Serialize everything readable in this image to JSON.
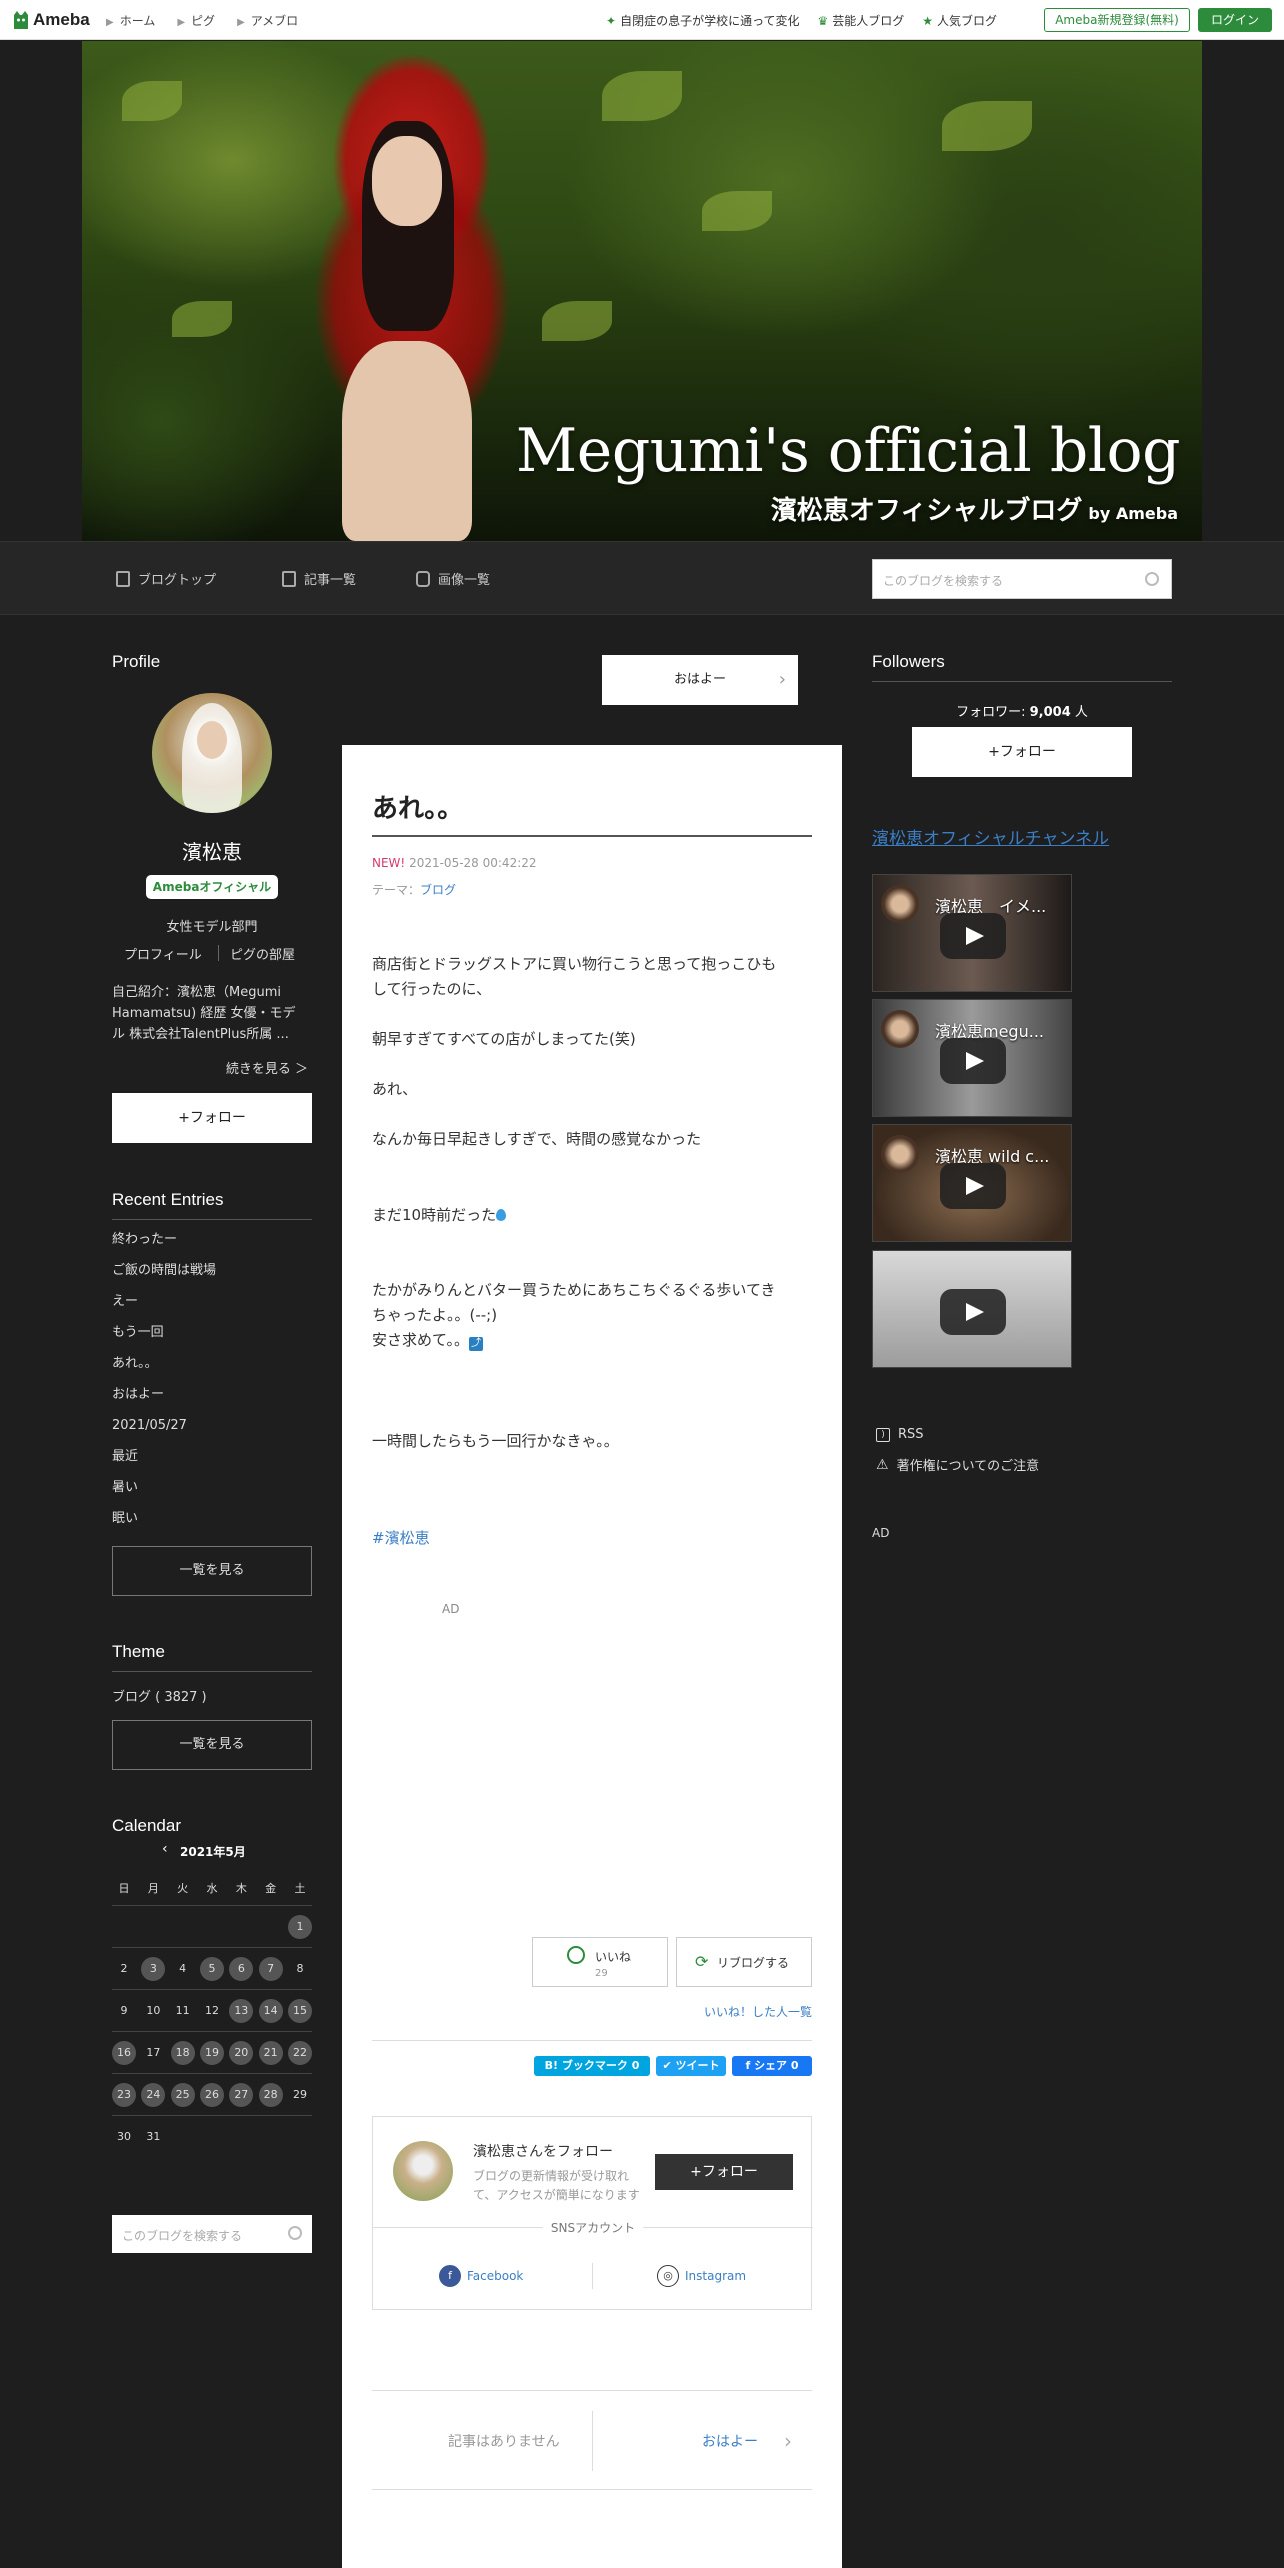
{
  "topbar": {
    "logo": "Ameba",
    "nav": [
      "ホーム",
      "ピグ",
      "アメブロ"
    ],
    "links": [
      "自閉症の息子が学校に通って変化",
      "芸能人ブログ",
      "人気ブログ"
    ],
    "register": "Ameba新規登録(無料)",
    "login": "ログイン"
  },
  "hero": {
    "title": "Megumi's official blog",
    "subtitle": "濱松恵オフィシャルブログ",
    "by": "by Ameba"
  },
  "navbar": {
    "items": [
      "ブログトップ",
      "記事一覧",
      "画像一覧"
    ],
    "search_placeholder": "このブログを検索する"
  },
  "left": {
    "profile_heading": "Profile",
    "name": "濱松恵",
    "badge": "Amebaオフィシャル",
    "occupation": "女性モデル部門",
    "profile_link": "プロフィール",
    "pigg_link": "ピグの部屋",
    "intro_1": "自己紹介：濱松恵（Megumi",
    "intro_2": "Hamamatsu) 経歴 女優・モデ",
    "intro_3": "ル 株式会社TalentPlus所属 ...",
    "read_more": "続きを見る ＞",
    "follow": "+フォロー",
    "recent_heading": "Recent Entries",
    "recent": [
      "終わったー",
      "ご飯の時間は戦場",
      "えー",
      "もう一回",
      "あれ。。",
      "おはよー",
      "2021/05/27",
      "最近",
      "暑い",
      "眠い"
    ],
    "see_all": "一覧を見る",
    "theme_heading": "Theme",
    "theme_item": "ブログ ( 3827 )",
    "theme_see_all": "一覧を見る",
    "calendar_heading": "Calendar",
    "calendar_month": "2021年5月",
    "weekdays": [
      "日",
      "月",
      "火",
      "水",
      "木",
      "金",
      "土"
    ],
    "search_placeholder": "このブログを検索する"
  },
  "article": {
    "prev_button": "おはよー",
    "title": "あれ。。",
    "new_label": "NEW!",
    "datetime": "2021-05-28 00:42:22",
    "theme_label": "テーマ：",
    "theme_value": "ブログ",
    "p1a": "商店街とドラッグストアに買い物行こうと思って抱っこひも",
    "p1b": "して行ったのに、",
    "p2": "朝早すぎてすべての店がしまってた(笑)",
    "p3": "あれ、",
    "p4": "なんか毎日早起きしすぎで、時間の感覚なかった",
    "p5": "まだ10時前だった",
    "p6a": "たかがみりんとバター買うためにあちこちぐるぐる歩いてき",
    "p6b": "ちゃったよ。。(--;)",
    "p6c": "安さ求めて。。",
    "p7": "一時間したらもう一回行かなきゃ。。",
    "hashtag": "#濱松恵",
    "ad": "AD",
    "like_label": "いいね",
    "like_count": "29",
    "reblog": "リブログする",
    "like_list": "いいね！した人一覧",
    "hatena": "B! ブックマーク 0",
    "tweet": "ツイート",
    "fb_share": "シェア 0",
    "follow_title": "濱松恵さんをフォロー",
    "follow_desc_1": "ブログの更新情報が受け取れ",
    "follow_desc_2": "て、アクセスが簡単になります",
    "follow_button": "+フォロー",
    "sns_label": "SNSアカウント",
    "facebook": "Facebook",
    "instagram": "Instagram",
    "no_articles": "記事はありません",
    "next_label": "おはよー"
  },
  "right": {
    "followers_heading": "Followers",
    "follower_label": "フォロワー:",
    "follower_count": "9,004",
    "follower_unit": "人",
    "follow": "+フォロー",
    "channel_link": "濱松恵オフィシャルチャンネル",
    "videos": [
      "濱松恵　イメ...",
      "濱松恵megu...",
      "濱松恵 wild c...",
      ""
    ],
    "rss": "RSS",
    "copyright": "著作権についてのご注意",
    "ad": "AD"
  },
  "colors": {
    "accent": "#2d8c3c",
    "link": "#3a7fc6",
    "new": "#d7396e",
    "background": "#1e1e1e"
  }
}
